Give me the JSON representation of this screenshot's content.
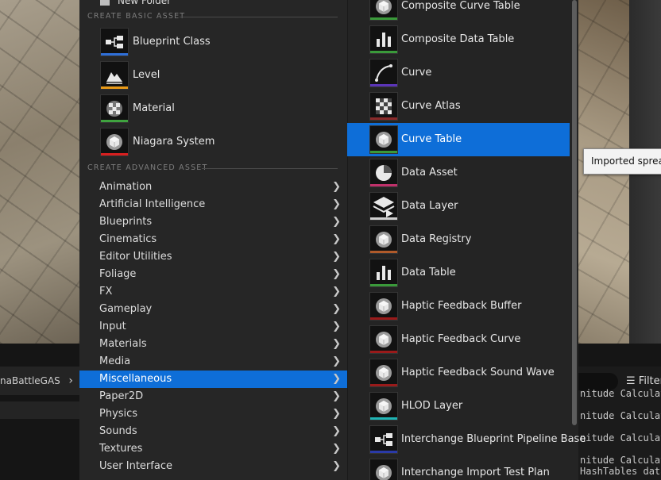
{
  "top_partial": {
    "new_folder_label": "New Folder"
  },
  "sections": {
    "basic": "CREATE BASIC ASSET",
    "advanced": "CREATE ADVANCED ASSET"
  },
  "basic_assets": [
    {
      "label": "Blueprint Class",
      "icon": "blueprint-icon",
      "color": "#2f6fd8"
    },
    {
      "label": "Level",
      "icon": "level-icon",
      "color": "#e89a18"
    },
    {
      "label": "Material",
      "icon": "material-icon",
      "color": "#3fa33f"
    },
    {
      "label": "Niagara System",
      "icon": "niagara-icon",
      "color": "#d81f1f"
    }
  ],
  "categories": [
    {
      "label": "Animation"
    },
    {
      "label": "Artificial Intelligence"
    },
    {
      "label": "Blueprints"
    },
    {
      "label": "Cinematics"
    },
    {
      "label": "Editor Utilities"
    },
    {
      "label": "Foliage"
    },
    {
      "label": "FX"
    },
    {
      "label": "Gameplay"
    },
    {
      "label": "Input"
    },
    {
      "label": "Materials"
    },
    {
      "label": "Media"
    },
    {
      "label": "Miscellaneous",
      "selected": true
    },
    {
      "label": "Paper2D"
    },
    {
      "label": "Physics"
    },
    {
      "label": "Sounds"
    },
    {
      "label": "Textures"
    },
    {
      "label": "User Interface"
    }
  ],
  "submenu_items": [
    {
      "label": "Composite Curve Table",
      "icon": "cube-icon",
      "color": "#3a9a3a"
    },
    {
      "label": "Composite Data Table",
      "icon": "bar-chart-icon",
      "color": "#3a9a3a"
    },
    {
      "label": "Curve",
      "icon": "curve-icon",
      "color": "#5b34b8"
    },
    {
      "label": "Curve Atlas",
      "icon": "checker-icon",
      "color": "#8a2a2a"
    },
    {
      "label": "Curve Table",
      "icon": "cube-icon",
      "color": "#3a9a3a",
      "selected": true
    },
    {
      "label": "Data Asset",
      "icon": "pie-icon",
      "color": "#c0306a"
    },
    {
      "label": "Data Layer",
      "icon": "layers-icon",
      "color": "#cfcfcf"
    },
    {
      "label": "Data Registry",
      "icon": "cube-icon",
      "color": "#b05a2a"
    },
    {
      "label": "Data Table",
      "icon": "bar-chart-icon",
      "color": "#3a9a3a"
    },
    {
      "label": "Haptic Feedback Buffer",
      "icon": "cube-icon",
      "color": "#9a1a1a"
    },
    {
      "label": "Haptic Feedback Curve",
      "icon": "cube-icon",
      "color": "#9a1a1a"
    },
    {
      "label": "Haptic Feedback Sound Wave",
      "icon": "cube-icon",
      "color": "#9a1a1a"
    },
    {
      "label": "HLOD Layer",
      "icon": "cube-icon",
      "color": "#1fb4b4"
    },
    {
      "label": "Interchange Blueprint Pipeline Base",
      "icon": "blueprint-icon",
      "color": "#2a3aa8"
    },
    {
      "label": "Interchange Import Test Plan",
      "icon": "cube-icon",
      "color": "#3a3a3a"
    }
  ],
  "tooltip": {
    "text": "Imported spread"
  },
  "bottom": {
    "breadcrumb": "naBattleGAS",
    "filter_label": "Filter",
    "log_lines": [
      "nitude Calculat",
      "nitude Calculat",
      "nitude Calculat",
      "nitude Calculat",
      "HashTables data"
    ]
  }
}
